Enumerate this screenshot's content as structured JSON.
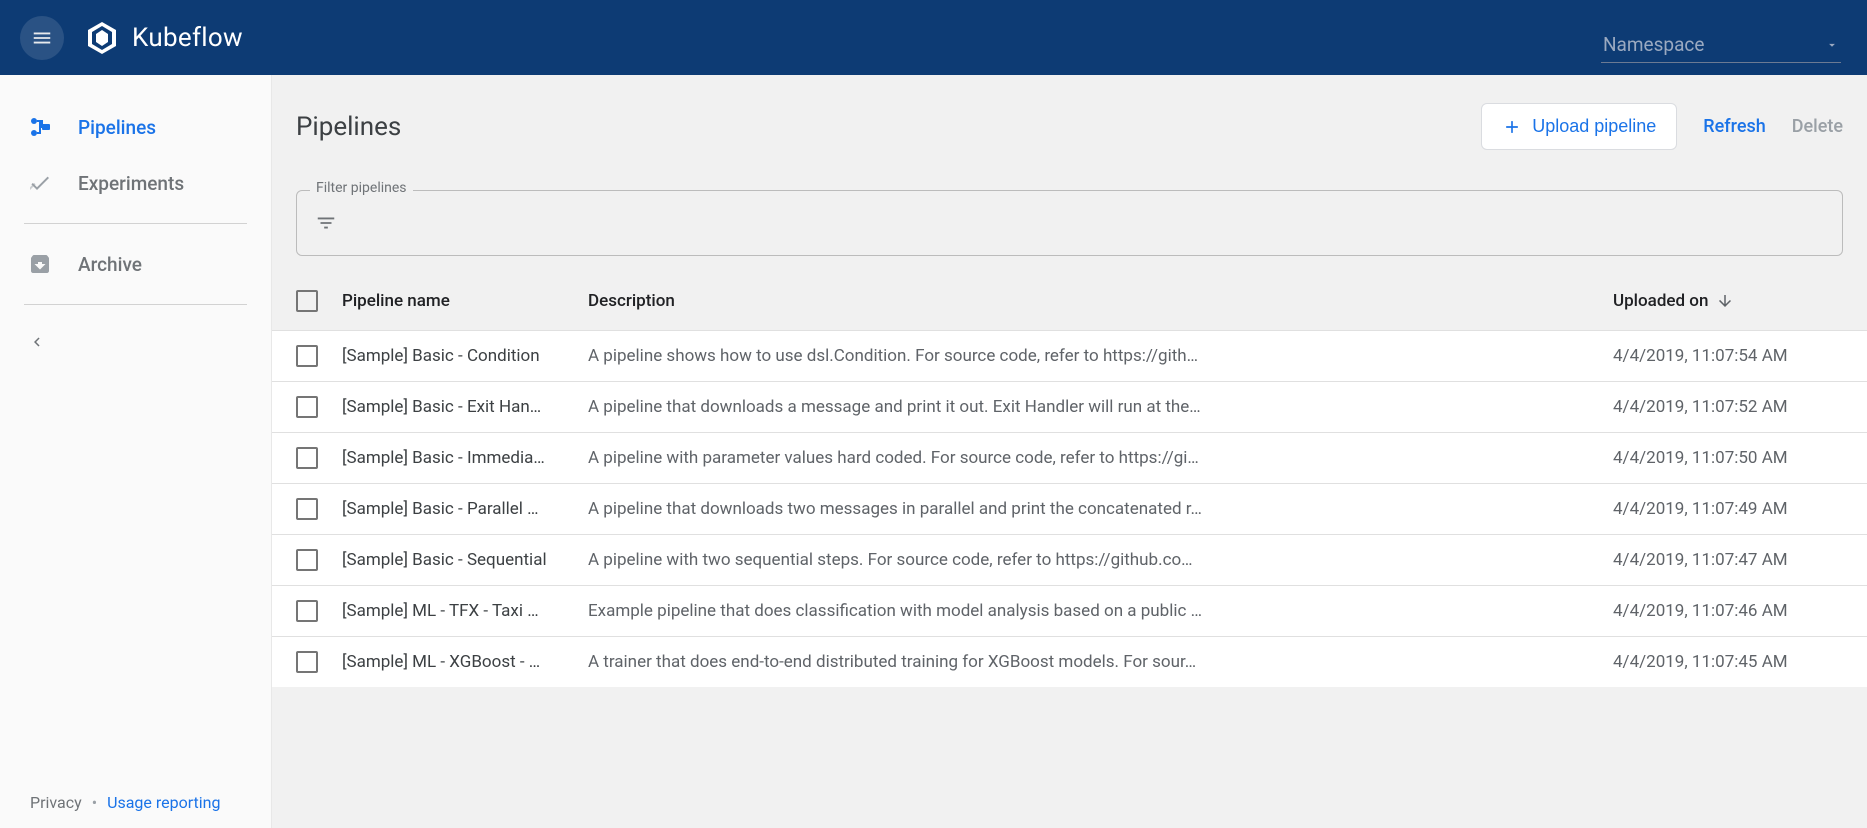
{
  "header": {
    "brand": "Kubeflow",
    "namespace_label": "Namespace"
  },
  "sidebar": {
    "pipelines": "Pipelines",
    "experiments": "Experiments",
    "archive": "Archive"
  },
  "footer": {
    "privacy": "Privacy",
    "usage": "Usage reporting"
  },
  "page": {
    "title": "Pipelines",
    "upload": "Upload pipeline",
    "refresh": "Refresh",
    "delete": "Delete",
    "filter_label": "Filter pipelines"
  },
  "columns": {
    "name": "Pipeline name",
    "desc": "Description",
    "uploaded": "Uploaded on"
  },
  "rows": [
    {
      "name": "[Sample] Basic - Condition",
      "desc": "A pipeline shows how to use dsl.Condition. For source code, refer to https://gith…",
      "date": "4/4/2019, 11:07:54 AM"
    },
    {
      "name": "[Sample] Basic - Exit Han…",
      "desc": "A pipeline that downloads a message and print it out. Exit Handler will run at the…",
      "date": "4/4/2019, 11:07:52 AM"
    },
    {
      "name": "[Sample] Basic - Immedia…",
      "desc": "A pipeline with parameter values hard coded. For source code, refer to https://gi…",
      "date": "4/4/2019, 11:07:50 AM"
    },
    {
      "name": "[Sample] Basic - Parallel …",
      "desc": "A pipeline that downloads two messages in parallel and print the concatenated r…",
      "date": "4/4/2019, 11:07:49 AM"
    },
    {
      "name": "[Sample] Basic - Sequential",
      "desc": "A pipeline with two sequential steps. For source code, refer to https://github.co…",
      "date": "4/4/2019, 11:07:47 AM"
    },
    {
      "name": "[Sample] ML - TFX - Taxi …",
      "desc": "Example pipeline that does classification with model analysis based on a public …",
      "date": "4/4/2019, 11:07:46 AM"
    },
    {
      "name": "[Sample] ML - XGBoost - …",
      "desc": "A trainer that does end-to-end distributed training for XGBoost models. For sour…",
      "date": "4/4/2019, 11:07:45 AM"
    }
  ]
}
